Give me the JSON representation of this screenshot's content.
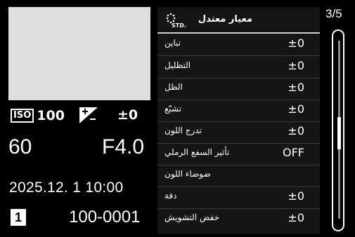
{
  "left_panel": {
    "iso_label": "ISO",
    "iso_value": "100",
    "exposure_comp": "±0",
    "shutter": "60",
    "aperture": "F4.0",
    "datetime": "2025.12.  1 10:00",
    "card_slot": "1",
    "file_number": "100-0001"
  },
  "menu": {
    "header_icon_label": "STD.",
    "title": "معيار معتدل",
    "items": [
      {
        "label": "تباين",
        "value": "±0"
      },
      {
        "label": "التظليل",
        "value": "±0"
      },
      {
        "label": "الظل",
        "value": "±0"
      },
      {
        "label": "تشبّع",
        "value": "±0"
      },
      {
        "label": "تدرج اللون",
        "value": "±0"
      },
      {
        "label": "تأثير السفع الرملي",
        "value": "OFF"
      },
      {
        "label": "ضوضاء اللون",
        "value": ""
      },
      {
        "label": "دقة",
        "value": "±0"
      },
      {
        "label": "خفض التشويش",
        "value": "±0"
      }
    ]
  },
  "page_indicator": "3/5",
  "scroll_position": 0.43
}
